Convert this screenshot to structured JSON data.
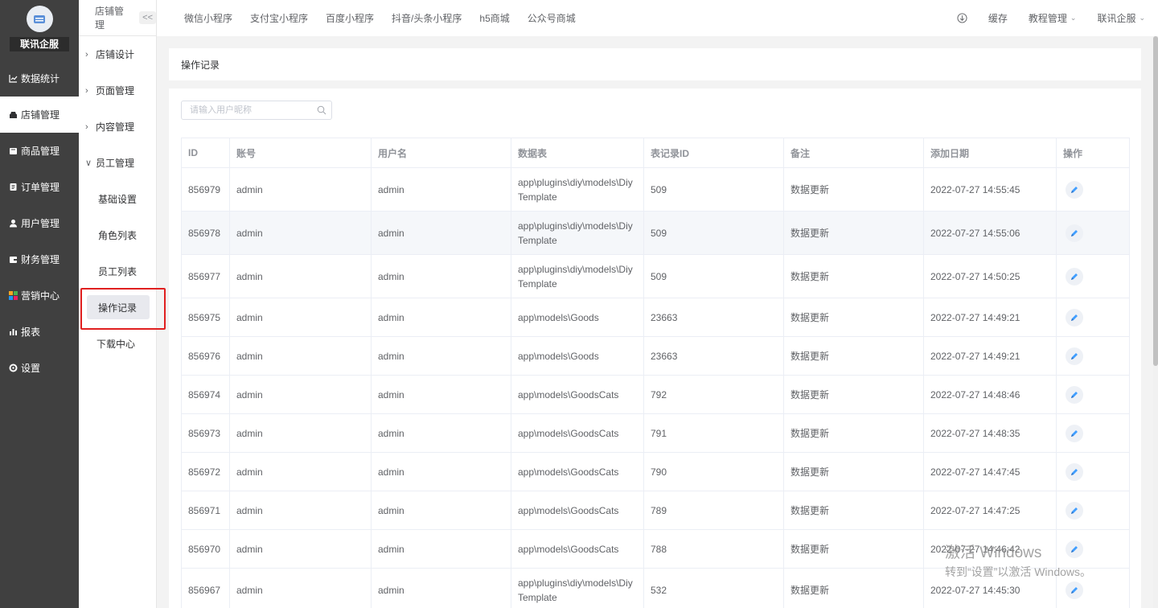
{
  "brand": {
    "name": "联讯企服"
  },
  "sidebar": {
    "items": [
      {
        "label": "数据统计",
        "icon": "chart-icon"
      },
      {
        "label": "店铺管理",
        "icon": "store-icon"
      },
      {
        "label": "商品管理",
        "icon": "goods-icon"
      },
      {
        "label": "订单管理",
        "icon": "order-icon"
      },
      {
        "label": "用户管理",
        "icon": "user-icon"
      },
      {
        "label": "财务管理",
        "icon": "finance-icon"
      },
      {
        "label": "营销中心",
        "icon": "marketing-icon"
      },
      {
        "label": "报表",
        "icon": "report-icon"
      },
      {
        "label": "设置",
        "icon": "settings-icon"
      }
    ]
  },
  "subnav": {
    "title": "店铺管理",
    "collapse": "<<",
    "groups": [
      {
        "label": "店铺设计"
      },
      {
        "label": "页面管理"
      },
      {
        "label": "内容管理"
      },
      {
        "label": "员工管理"
      }
    ],
    "children": [
      "基础设置",
      "角色列表",
      "员工列表",
      "操作记录"
    ],
    "extra": "下载中心"
  },
  "topbar": {
    "tabs": [
      "微信小程序",
      "支付宝小程序",
      "百度小程序",
      "抖音/头条小程序",
      "h5商城",
      "公众号商城"
    ],
    "cache": "缓存",
    "tutorial": "教程管理",
    "account": "联讯企服"
  },
  "breadcrumb": "操作记录",
  "search": {
    "placeholder": "请输入用户昵称"
  },
  "table": {
    "headers": [
      "ID",
      "账号",
      "用户名",
      "数据表",
      "表记录ID",
      "备注",
      "添加日期",
      "操作"
    ],
    "rows": [
      [
        "856979",
        "admin",
        "admin",
        "app\\plugins\\diy\\models\\DiyTemplate",
        "509",
        "数据更新",
        "2022-07-27 14:55:45"
      ],
      [
        "856978",
        "admin",
        "admin",
        "app\\plugins\\diy\\models\\DiyTemplate",
        "509",
        "数据更新",
        "2022-07-27 14:55:06"
      ],
      [
        "856977",
        "admin",
        "admin",
        "app\\plugins\\diy\\models\\DiyTemplate",
        "509",
        "数据更新",
        "2022-07-27 14:50:25"
      ],
      [
        "856975",
        "admin",
        "admin",
        "app\\models\\Goods",
        "23663",
        "数据更新",
        "2022-07-27 14:49:21"
      ],
      [
        "856976",
        "admin",
        "admin",
        "app\\models\\Goods",
        "23663",
        "数据更新",
        "2022-07-27 14:49:21"
      ],
      [
        "856974",
        "admin",
        "admin",
        "app\\models\\GoodsCats",
        "792",
        "数据更新",
        "2022-07-27 14:48:46"
      ],
      [
        "856973",
        "admin",
        "admin",
        "app\\models\\GoodsCats",
        "791",
        "数据更新",
        "2022-07-27 14:48:35"
      ],
      [
        "856972",
        "admin",
        "admin",
        "app\\models\\GoodsCats",
        "790",
        "数据更新",
        "2022-07-27 14:47:45"
      ],
      [
        "856971",
        "admin",
        "admin",
        "app\\models\\GoodsCats",
        "789",
        "数据更新",
        "2022-07-27 14:47:25"
      ],
      [
        "856970",
        "admin",
        "admin",
        "app\\models\\GoodsCats",
        "788",
        "数据更新",
        "2022-07-27 14:46:42"
      ],
      [
        "856967",
        "admin",
        "admin",
        "app\\plugins\\diy\\models\\DiyTemplate",
        "532",
        "数据更新",
        "2022-07-27 14:45:30"
      ]
    ]
  },
  "watermark": {
    "line1": "激活 Windows",
    "line2": "转到“设置”以激活 Windows。"
  },
  "colors": {
    "sidebar_bg": "#404040",
    "accent": "#409eff",
    "highlight": "#e02020"
  }
}
